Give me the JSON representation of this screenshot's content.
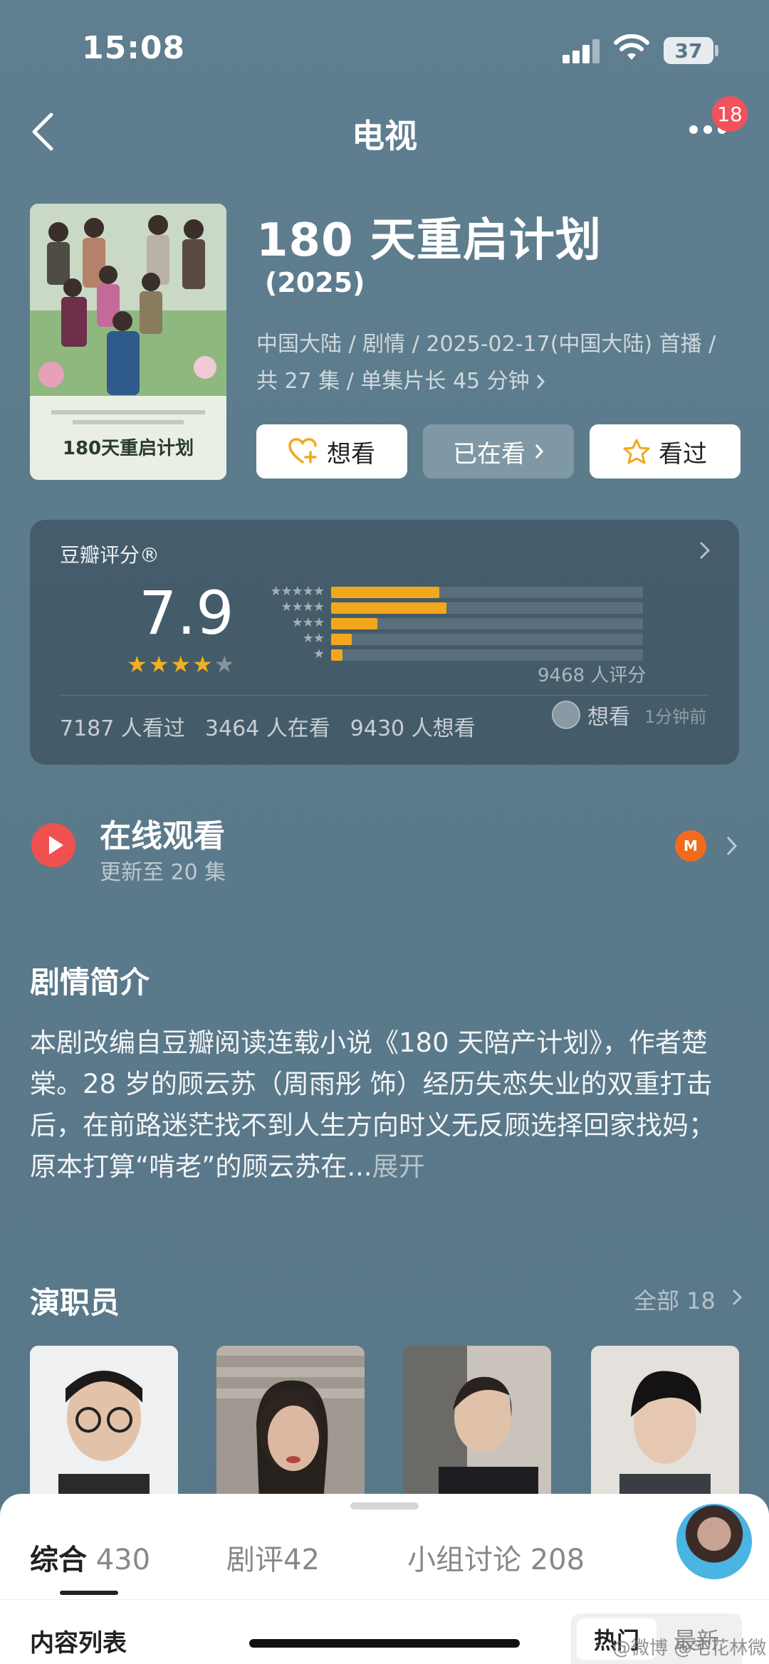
{
  "status_bar": {
    "time": "15:08",
    "battery": "37"
  },
  "nav": {
    "title": "电视",
    "badge": "18"
  },
  "movie": {
    "title": "180 天重启计划",
    "year": "(2025)",
    "meta_line1": "中国大陆 / 剧情 / 2025-02-17(中国大陆) 首播 /",
    "meta_line2": "共 27 集 / 单集片长 45 分钟",
    "poster_caption": "180天重启计划"
  },
  "actions": {
    "want": "想看",
    "watching": "已在看",
    "watched": "看过"
  },
  "rating": {
    "label": "豆瓣评分®",
    "score": "7.9",
    "stars_filled": 4,
    "distribution": [
      {
        "stars": "★★★★★",
        "fraction": 0.235
      },
      {
        "stars": "★★★★",
        "fraction": 0.25
      },
      {
        "stars": "★★★",
        "fraction": 0.1
      },
      {
        "stars": "★★",
        "fraction": 0.045
      },
      {
        "stars": "★",
        "fraction": 0.025
      }
    ],
    "count": "9468 人评分",
    "watched": "7187 人看过",
    "watching": "3464 人在看",
    "wanting": "9430 人想看",
    "friend_action": "想看",
    "friend_time": "1分钟前"
  },
  "online": {
    "title": "在线观看",
    "subtitle": "更新至 20 集",
    "platform_icon": "mango-tv-icon",
    "platform_text": "M"
  },
  "synopsis": {
    "title": "剧情简介",
    "text": "本剧改编自豆瓣阅读连载小说《180 天陪产计划》，作者楚棠。28 岁的顾云苏（周雨彤 饰）经历失恋失业的双重打击后，在前路迷茫找不到人生方向时义无反顾选择回家找妈；原本打算“啃老”的顾云苏在...",
    "more": "展开"
  },
  "cast": {
    "title": "演职员",
    "all": "全部 18"
  },
  "sheet": {
    "tabs": [
      {
        "label": "综合",
        "count": "430"
      },
      {
        "label": "剧评",
        "count": "42"
      },
      {
        "label": "小组讨论",
        "count": "208"
      }
    ],
    "list_title": "内容列表",
    "sort_hot": "热门",
    "sort_new": "最新"
  },
  "watermark": "@微博 @宅花林微笑"
}
